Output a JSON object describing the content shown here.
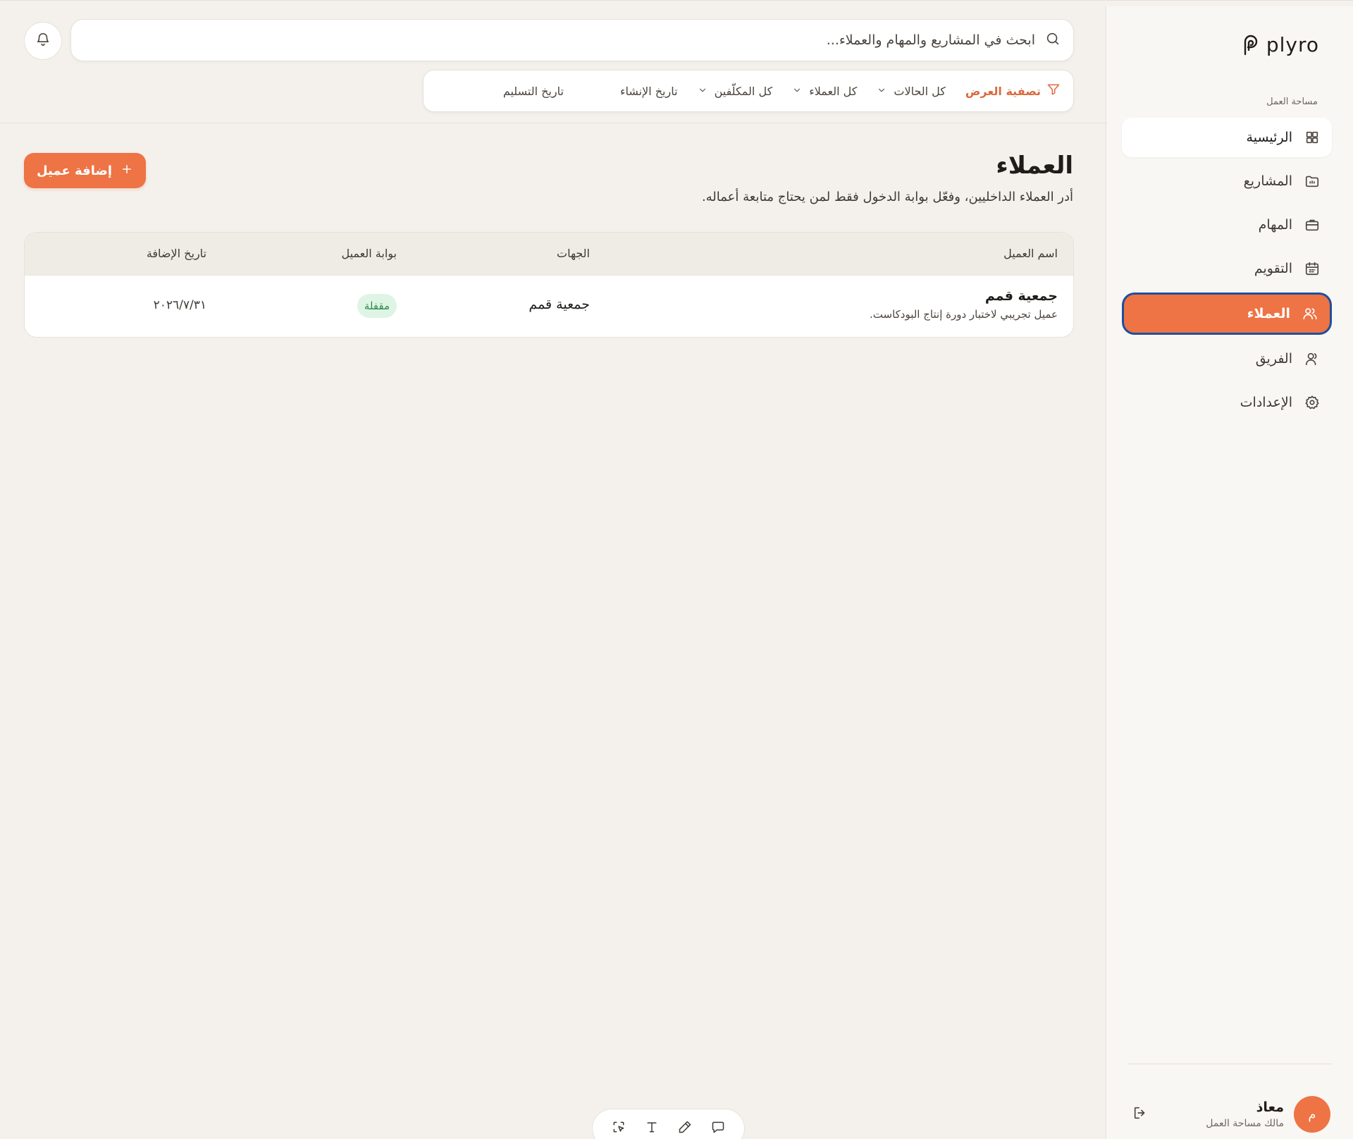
{
  "app": {
    "brand_name": "plyro",
    "accent_color": "#ee7345"
  },
  "sidebar": {
    "workspace_label": "مساحة العمل",
    "items": [
      {
        "label": "الرئيسية",
        "icon": "grid-icon"
      },
      {
        "label": "المشاريع",
        "icon": "folder-icon"
      },
      {
        "label": "المهام",
        "icon": "briefcase-icon"
      },
      {
        "label": "التقويم",
        "icon": "calendar-icon"
      },
      {
        "label": "العملاء",
        "icon": "users-icon",
        "active": true
      },
      {
        "label": "الفريق",
        "icon": "user-icon"
      },
      {
        "label": "الإعدادات",
        "icon": "gear-icon"
      }
    ],
    "user": {
      "initial": "م",
      "name": "معاذ",
      "role": "مالك مساحة العمل"
    }
  },
  "search": {
    "placeholder": "ابحث في المشاريع والمهام والعملاء..."
  },
  "filters": {
    "title": "تصفية العرض",
    "status": "كل الحالات",
    "clients": "كل العملاء",
    "assignees": "كل المكلّفين",
    "created": "تاريخ الإنشاء",
    "delivery": "تاريخ التسليم"
  },
  "page": {
    "title": "العملاء",
    "subtitle": "أدر العملاء الداخليين، وفعّل بوابة الدخول فقط لمن يحتاج متابعة أعماله.",
    "add_button": "إضافة عميل"
  },
  "table": {
    "headers": {
      "name": "اسم العميل",
      "entities": "الجهات",
      "portal": "بوابة العميل",
      "date": "تاريخ الإضافة"
    },
    "rows": [
      {
        "name": "جمعية قمم",
        "description": "عميل تجريبي لاختبار دورة إنتاج البودكاست.",
        "entities": "جمعية قمم",
        "portal": "مقفلة",
        "date": "٢٠٢٦/٧/٣١"
      }
    ]
  }
}
